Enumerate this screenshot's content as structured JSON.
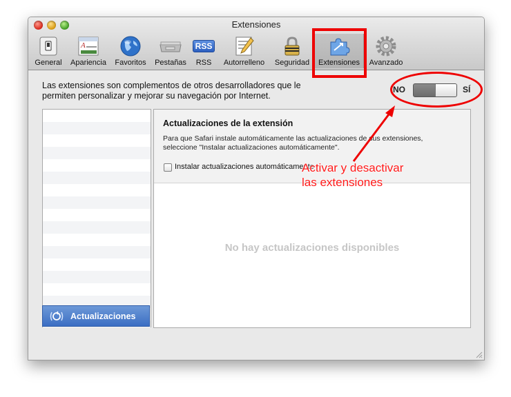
{
  "window": {
    "title": "Extensiones"
  },
  "toolbar": {
    "items": [
      {
        "label": "General",
        "icon": "general-switch-icon"
      },
      {
        "label": "Apariencia",
        "icon": "appearance-icon"
      },
      {
        "label": "Favoritos",
        "icon": "globe-icon"
      },
      {
        "label": "Pestañas",
        "icon": "tabs-icon"
      },
      {
        "label": "RSS",
        "icon": "rss-icon",
        "badge": "RSS"
      },
      {
        "label": "Autorrelleno",
        "icon": "pencil-form-icon"
      },
      {
        "label": "Seguridad",
        "icon": "lock-icon"
      },
      {
        "label": "Extensiones",
        "icon": "puzzle-icon",
        "selected": true
      },
      {
        "label": "Avanzado",
        "icon": "gear-icon"
      }
    ]
  },
  "intro": {
    "text_line1": "Las extensiones son complementos de otros desarrolladores que le",
    "text_line2": "permiten personalizar y mejorar su navegación por Internet."
  },
  "master_switch": {
    "off_label": "NO",
    "on_label": "SÍ",
    "state": "on"
  },
  "sidebar": {
    "selected_item": {
      "label": "Actualizaciones",
      "icon": "updates-icon"
    }
  },
  "detail": {
    "title": "Actualizaciones de la extensión",
    "description_line1": "Para que Safari instale automáticamente las actualizaciones de sus extensiones,",
    "description_line2": "seleccione \"Instalar actualizaciones automáticamente\".",
    "checkbox": {
      "label": "Instalar actualizaciones automáticamente",
      "checked": false
    },
    "empty_message": "No hay actualizaciones disponibles"
  },
  "annotation": {
    "line1": "Activar y desactivar",
    "line2": "las extensiones",
    "color": "#ee0000"
  },
  "colors": {
    "selection_blue": "#3b6ec3",
    "annotation_red": "#ee0000"
  }
}
